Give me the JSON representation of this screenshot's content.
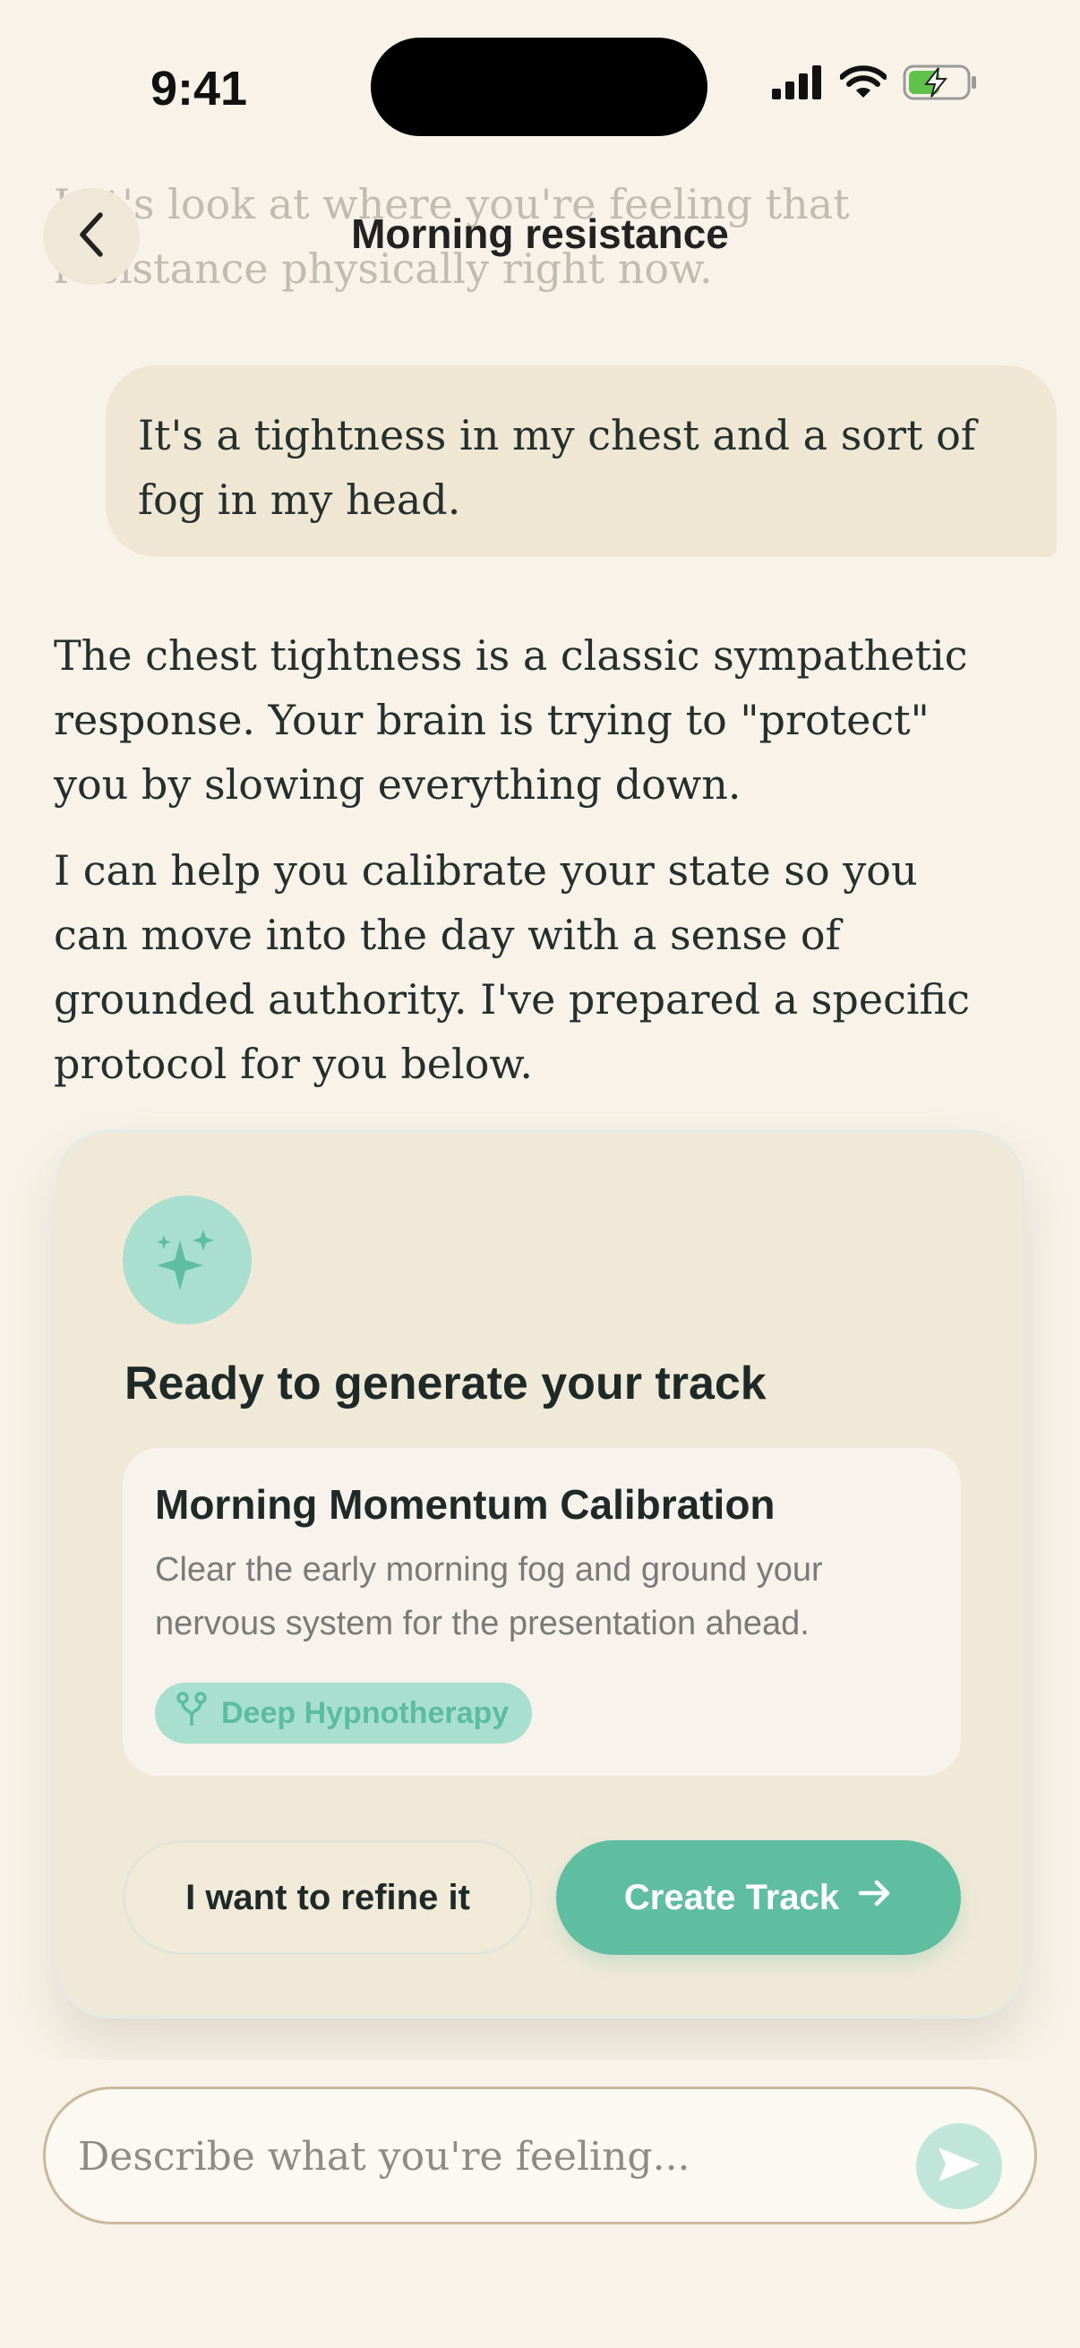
{
  "status_bar": {
    "time": "9:41",
    "icons": [
      "cellular-signal-icon",
      "wifi-icon",
      "battery-charging-icon"
    ],
    "battery_color": "#5fc24a"
  },
  "header": {
    "title": "Morning resistance",
    "back_icon": "chevron-left-icon"
  },
  "conversation": {
    "faded_assistant_text": "Let's look at where you're feeling that resistance physically right now.",
    "user_message": "It's a tightness in my chest and a sort of fog in my head.",
    "assistant_paragraphs": [
      "The chest tightness is a classic sympathetic response. Your brain is trying to \"protect\" you by slowing everything down.",
      "I can help you calibrate your state so you can move into the day with a sense of grounded authority. I've prepared a specific protocol for you below."
    ]
  },
  "track_card": {
    "icon": "sparkles-icon",
    "title": "Ready to generate your track",
    "track_name": "Morning Momentum Calibration",
    "track_description": "Clear the early morning fog and ground your nervous system for the presentation ahead.",
    "tag_icon": "fork-branch-icon",
    "tag_label": "Deep Hypnotherapy",
    "refine_label": "I want to refine it",
    "create_label": "Create Track",
    "create_icon": "arrow-right-icon"
  },
  "composer": {
    "placeholder": "Describe what you're feeling...",
    "send_icon": "send-icon"
  },
  "colors": {
    "background": "#f8f2e8",
    "accent": "#5fbe9f",
    "accent_light": "#a9dfcf",
    "card_background": "#f1e9d8",
    "user_bubble": "#efe6d4"
  }
}
